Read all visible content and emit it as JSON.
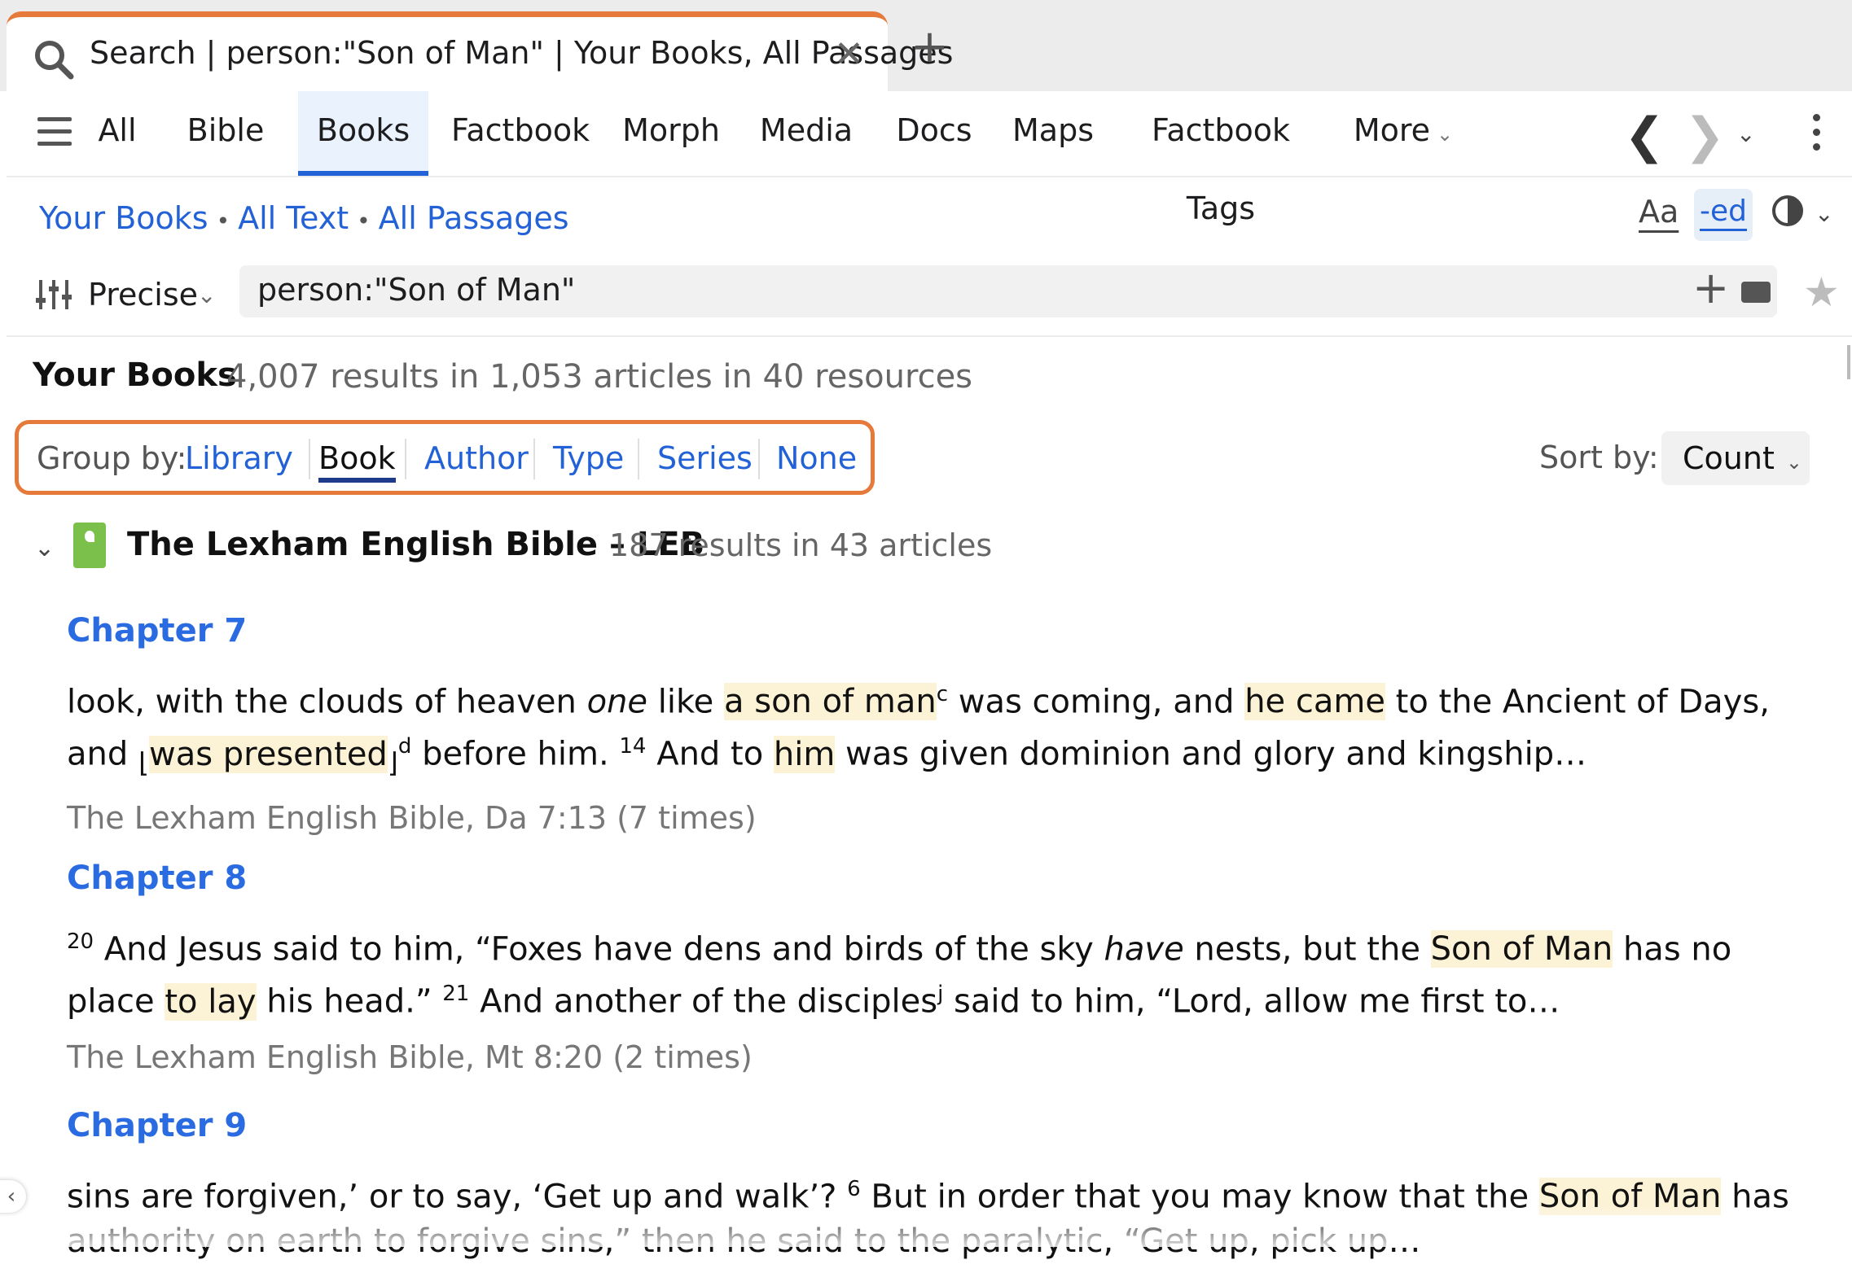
{
  "tab": {
    "title": "Search | person:\"Son of Man\" | Your Books, All Passages",
    "close_glyph": "✕",
    "add_glyph": "+"
  },
  "nav": {
    "tabs": [
      "All",
      "Bible",
      "Books",
      "Factbook",
      "Morph",
      "Media",
      "Docs",
      "Maps",
      "Factbook Tags",
      "More"
    ],
    "active_tab": "Books",
    "back_glyph": "❮",
    "forward_glyph": "❯",
    "history_glyph": "⌄"
  },
  "breadcrumb": {
    "items": [
      "Your Books",
      "All Text",
      "All Passages"
    ],
    "separator": "•"
  },
  "toolbar": {
    "text_size_label": "Aa",
    "ed_label": "-ed"
  },
  "search": {
    "mode": "Precise",
    "query": "person:\"Son of Man\"",
    "add_glyph": "+",
    "star_glyph": "★"
  },
  "results": {
    "title": "Your Books",
    "summary": "4,007 results in 1,053 articles in 40 resources"
  },
  "group_by": {
    "label": "Group by:",
    "options": [
      "Library",
      "Book",
      "Author",
      "Type",
      "Series",
      "None"
    ],
    "active": "Book"
  },
  "sort_by": {
    "label": "Sort by:",
    "value": "Count"
  },
  "group": {
    "title": "The Lexham English Bible – LEB",
    "summary": "187 results in 43 articles"
  },
  "items": [
    {
      "heading": "Chapter 7",
      "segments": [
        {
          "t": "look, with the clouds of heaven "
        },
        {
          "t": "one",
          "style": "em"
        },
        {
          "t": " like "
        },
        {
          "t": "a son of man",
          "style": "hl"
        },
        {
          "t": "c",
          "style": "sup"
        },
        {
          "t": " was coming, and "
        },
        {
          "t": "he came",
          "style": "hl"
        },
        {
          "t": " to the Ancient of Days, and "
        },
        {
          "t": "⌊",
          "style": "sub"
        },
        {
          "t": "was presented",
          "style": "hl"
        },
        {
          "t": "⌋",
          "style": "sub"
        },
        {
          "t": "d",
          "style": "sup"
        },
        {
          "t": " before him. "
        },
        {
          "t": "14",
          "style": "sup"
        },
        {
          "t": " And to "
        },
        {
          "t": "him",
          "style": "hl"
        },
        {
          "t": " was given dominion and glory and kingship…"
        }
      ],
      "citation": "The Lexham English Bible, Da 7:13 (7 times)"
    },
    {
      "heading": "Chapter 8",
      "segments": [
        {
          "t": "20",
          "style": "sup"
        },
        {
          "t": " And Jesus said to him, “Foxes have dens and birds of the sky "
        },
        {
          "t": "have",
          "style": "em"
        },
        {
          "t": " nests, but the "
        },
        {
          "t": "Son of Man",
          "style": "hl"
        },
        {
          "t": " has no place "
        },
        {
          "t": "to lay",
          "style": "hl"
        },
        {
          "t": " his head.” "
        },
        {
          "t": "21",
          "style": "sup"
        },
        {
          "t": " And another of the disciples"
        },
        {
          "t": "j",
          "style": "sup"
        },
        {
          "t": " said to him, “Lord, allow me first to…"
        }
      ],
      "citation": "The Lexham English Bible, Mt 8:20 (2 times)"
    },
    {
      "heading": "Chapter 9",
      "segments": [
        {
          "t": "sins are forgiven,’ or to say, ‘Get up and walk’? "
        },
        {
          "t": "6",
          "style": "sup"
        },
        {
          "t": " But in order that you may know that the "
        },
        {
          "t": "Son of Man",
          "style": "hl"
        },
        {
          "t": " has authority on earth to forgive sins,” then he said to the paralytic, “Get up, pick up…"
        }
      ],
      "citation": ""
    }
  ],
  "colors": {
    "accent_orange": "#e67a3a",
    "link_blue": "#2361d6",
    "heading_blue": "#2a6be2",
    "highlight": "#fcf2d6"
  }
}
